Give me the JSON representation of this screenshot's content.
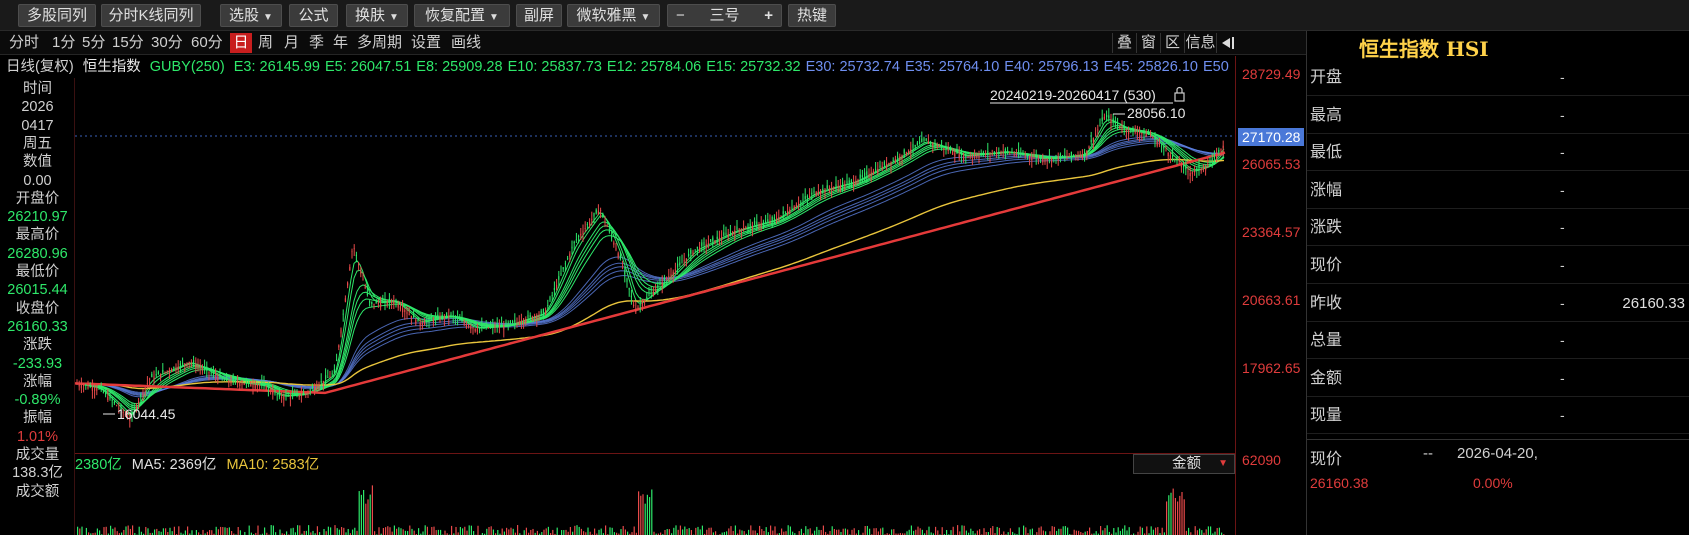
{
  "toolbar": {
    "items": [
      "多股同列",
      "分时K线同列",
      "选股",
      "公式",
      "换肤",
      "恢复配置",
      "副屏",
      "微软雅黑",
      "三号",
      "热键"
    ],
    "minus": "−",
    "plus": "+"
  },
  "periods": [
    "分时",
    "1分",
    "5分",
    "15分",
    "30分",
    "60分",
    "日",
    "周",
    "月",
    "季",
    "年",
    "多周期",
    "设置",
    "画线"
  ],
  "active_period": "日",
  "right_buttons": [
    "叠",
    "窗",
    "区",
    "信息"
  ],
  "indicator": {
    "title": "日线(复权)",
    "name": "恒生指数",
    "formula": "GUBY(250)",
    "values": [
      {
        "label": "E3: 26145.99",
        "color": "#2ee86a"
      },
      {
        "label": "E5: 26047.51",
        "color": "#2ee86a"
      },
      {
        "label": "E8: 25909.28",
        "color": "#2ee86a"
      },
      {
        "label": "E10: 25837.73",
        "color": "#2ee86a"
      },
      {
        "label": "E12: 25784.06",
        "color": "#2ee86a"
      },
      {
        "label": "E15: 25732.32",
        "color": "#2ee86a"
      },
      {
        "label": "E30: 25732.74",
        "color": "#6f8ff0"
      },
      {
        "label": "E35: 25764.10",
        "color": "#6f8ff0"
      },
      {
        "label": "E40: 25796.13",
        "color": "#6f8ff0"
      },
      {
        "label": "E45: 25826.10",
        "color": "#6f8ff0"
      },
      {
        "label": "E50",
        "color": "#6f8ff0"
      }
    ]
  },
  "left_panel": [
    {
      "text": "时间",
      "color": "#d0d0d0"
    },
    {
      "text": "2026",
      "color": "#d0d0d0"
    },
    {
      "text": "0417",
      "color": "#d0d0d0"
    },
    {
      "text": "周五",
      "color": "#d0d0d0"
    },
    {
      "text": "数值",
      "color": "#d0d0d0"
    },
    {
      "text": "0.00",
      "color": "#d0d0d0"
    },
    {
      "text": "开盘价",
      "color": "#d0d0d0"
    },
    {
      "text": "26210.97",
      "color": "#2ee86a"
    },
    {
      "text": "最高价",
      "color": "#d0d0d0"
    },
    {
      "text": "26280.96",
      "color": "#2ee86a"
    },
    {
      "text": "最低价",
      "color": "#d0d0d0"
    },
    {
      "text": "26015.44",
      "color": "#2ee86a"
    },
    {
      "text": "收盘价",
      "color": "#d0d0d0"
    },
    {
      "text": "26160.33",
      "color": "#2ee86a"
    },
    {
      "text": "涨跌",
      "color": "#d0d0d0"
    },
    {
      "text": "-233.93",
      "color": "#2ee86a"
    },
    {
      "text": "涨幅",
      "color": "#d0d0d0"
    },
    {
      "text": "-0.89%",
      "color": "#2ee86a"
    },
    {
      "text": "振幅",
      "color": "#d0d0d0"
    },
    {
      "text": "1.01%",
      "color": "#e03c3c"
    },
    {
      "text": "成交量",
      "color": "#d0d0d0"
    },
    {
      "text": "138.3亿",
      "color": "#d0d0d0"
    },
    {
      "text": "成交额",
      "color": "#d0d0d0"
    }
  ],
  "chart": {
    "range_label": "20240219-20260417 (530)",
    "high_label": "28056.10",
    "low_label": "16044.45",
    "current_price_tag": "27170.28"
  },
  "y_axis": {
    "ticks": [
      "28729.49",
      "26065.53",
      "23364.57",
      "20663.61",
      "17962.65"
    ],
    "volume_tick": "62090"
  },
  "volume": {
    "label1": "2380亿",
    "label2": "MA5: 2369亿",
    "label3": "MA10: 2583亿",
    "dropdown": "金额"
  },
  "quote": {
    "title": "恒生指数 HSI",
    "rows": [
      {
        "label": "开盘",
        "value": ""
      },
      {
        "label": "最高",
        "value": ""
      },
      {
        "label": "最低",
        "value": ""
      },
      {
        "label": "涨幅",
        "value": ""
      },
      {
        "label": "涨跌",
        "value": ""
      },
      {
        "label": "现价",
        "value": ""
      },
      {
        "label": "昨收",
        "value": "26160.33"
      },
      {
        "label": "总量",
        "value": ""
      },
      {
        "label": "金额",
        "value": ""
      },
      {
        "label": "现量",
        "value": ""
      }
    ],
    "footer_label": "现价",
    "footer_dash": "--",
    "footer_date": "2026-04-20,",
    "footer_price": "26160.38",
    "footer_pct": "0.00%"
  },
  "colors": {
    "green": "#2ee86a",
    "red": "#e03c3c",
    "blue": "#6f8ff0",
    "yellow": "#e8c43c",
    "gold": "#ffd24a"
  }
}
